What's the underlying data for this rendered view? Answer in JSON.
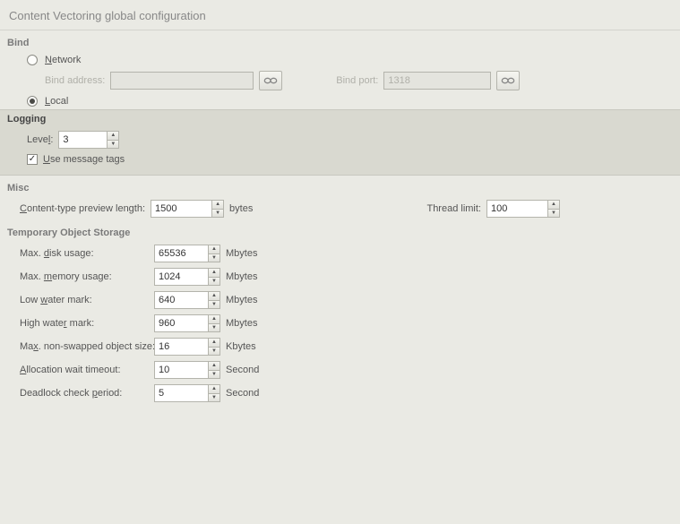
{
  "title": "Content Vectoring global configuration",
  "bind": {
    "heading": "Bind",
    "network_label": "Network",
    "local_label": "Local",
    "selected": "local",
    "address_label": "Bind address:",
    "address_value": "",
    "port_label": "Bind port:",
    "port_value": "1318"
  },
  "logging": {
    "heading": "Logging",
    "level_label": "Level:",
    "level_value": "3",
    "use_tags_label": "Use message tags",
    "use_tags_checked": true
  },
  "misc": {
    "heading": "Misc",
    "preview_label": "Content-type preview length:",
    "preview_value": "1500",
    "preview_unit": "bytes",
    "thread_label": "Thread limit:",
    "thread_value": "100"
  },
  "storage": {
    "heading": "Temporary Object Storage",
    "rows": [
      {
        "label_pre": "Max. ",
        "label_u": "d",
        "label_post": "isk usage:",
        "value": "65536",
        "unit": "Mbytes"
      },
      {
        "label_pre": "Max. ",
        "label_u": "m",
        "label_post": "emory usage:",
        "value": "1024",
        "unit": "Mbytes"
      },
      {
        "label_pre": "Low ",
        "label_u": "w",
        "label_post": "ater mark:",
        "value": "640",
        "unit": "Mbytes"
      },
      {
        "label_pre": "High wate",
        "label_u": "r",
        "label_post": " mark:",
        "value": "960",
        "unit": "Mbytes"
      },
      {
        "label_pre": "Ma",
        "label_u": "x",
        "label_post": ". non-swapped object size:",
        "value": "16",
        "unit": "Kbytes"
      },
      {
        "label_pre": "",
        "label_u": "A",
        "label_post": "llocation wait timeout:",
        "value": "10",
        "unit": "Second"
      },
      {
        "label_pre": "Deadlock check ",
        "label_u": "p",
        "label_post": "eriod:",
        "value": "5",
        "unit": "Second"
      }
    ]
  }
}
